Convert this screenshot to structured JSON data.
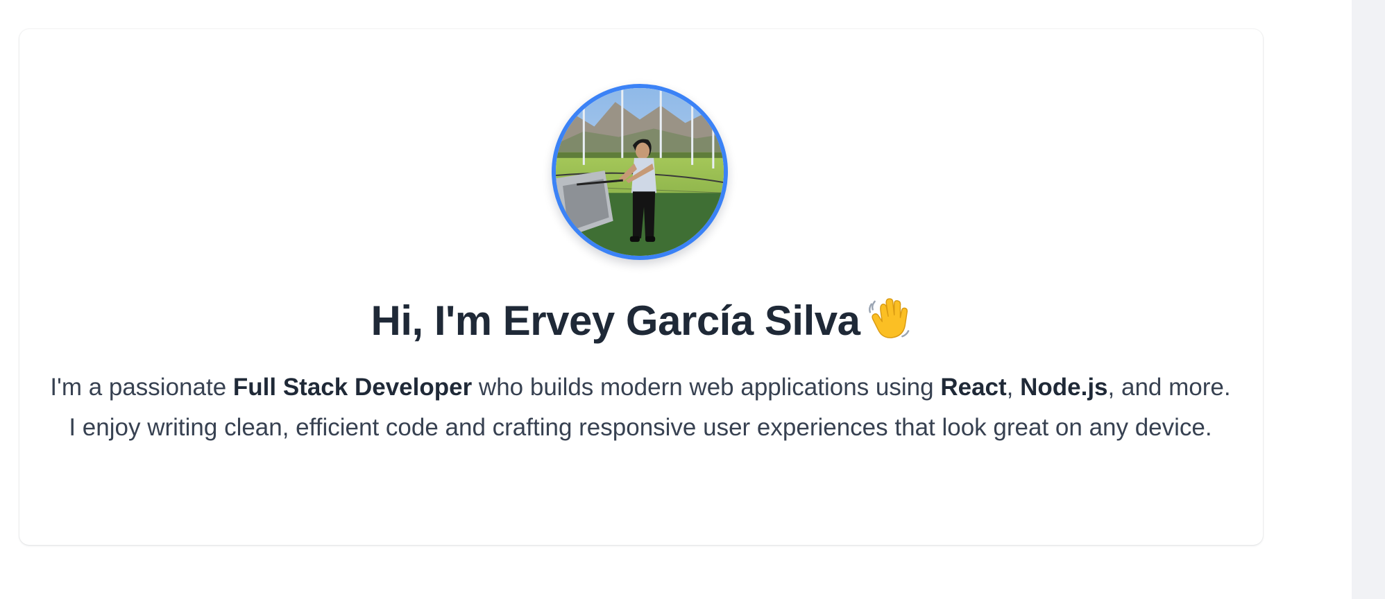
{
  "profile": {
    "photo_alt": "Ervey García Silva swinging a golf club at a driving range",
    "heading": {
      "text": "Hi, I'm Ervey García Silva",
      "emoji_icon": "waving-hand-icon"
    },
    "bio": {
      "intro": "I'm a passionate ",
      "role": "Full Stack Developer",
      "mid": " who builds modern web applications using ",
      "tech1": "React",
      "sep": ", ",
      "tech2": "Node.js",
      "outro": ", and more. I enjoy writing clean, efficient code and crafting responsive user experiences that look great on any device."
    }
  },
  "colors": {
    "accent": "#3b82f6",
    "heading": "#1f2937",
    "body_text": "#374151",
    "side_strip": "#f1f2f5"
  }
}
